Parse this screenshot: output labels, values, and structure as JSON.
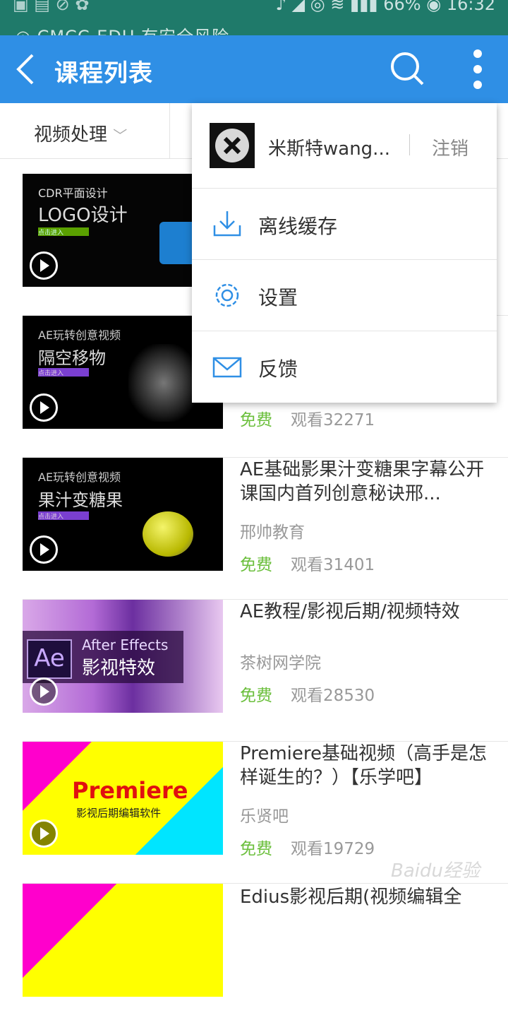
{
  "status_bar": {
    "battery": "66%",
    "time": "16:32"
  },
  "notification": "CMCC-EDU 有安全风险",
  "app_bar": {
    "title": "课程列表"
  },
  "filter": {
    "category": "视频处理"
  },
  "menu": {
    "user_name": "米斯特wang...",
    "logout_label": "注销",
    "items": [
      {
        "label": "离线缓存",
        "icon": "download-icon"
      },
      {
        "label": "设置",
        "icon": "gear-icon"
      },
      {
        "label": "反馈",
        "icon": "mail-icon"
      }
    ]
  },
  "courses": [
    {
      "thumb_lines": [
        "CDR平面设计",
        "LOGO设计",
        "点击进入"
      ],
      "title": "",
      "org": "",
      "price": "",
      "views": ""
    },
    {
      "thumb_lines": [
        "AE玩转创意视频",
        "隔空移物",
        "点击进入"
      ],
      "title": "",
      "org": "",
      "price": "免费",
      "views": "观看32271"
    },
    {
      "thumb_lines": [
        "AE玩转创意视频",
        "果汁变糖果",
        "点击进入"
      ],
      "title": "AE基础影果汁变糖果字幕公开课国内首列创意秘诀邢...",
      "org": "邢帅教育",
      "price": "免费",
      "views": "观看31401"
    },
    {
      "thumb_lines": [
        "After Effects",
        "影视特效",
        "Ae"
      ],
      "title": "AE教程/影视后期/视频特效",
      "org": "茶树网学院",
      "price": "免费",
      "views": "观看28530"
    },
    {
      "thumb_lines": [
        "Premiere",
        "影视后期编辑软件"
      ],
      "title": "Premiere基础视频（高手是怎样诞生的？）【乐学吧】",
      "org": "乐贤吧",
      "price": "免费",
      "views": "观看19729"
    },
    {
      "thumb_lines": [],
      "title": "Edius影视后期(视频编辑全",
      "org": "",
      "price": "",
      "views": ""
    }
  ],
  "watermark": "Baidu经验",
  "colors": {
    "appbar": "#2f8fe5",
    "statusbar": "#1f7a6a",
    "free": "#6bbf3c",
    "menu_icon": "#2f8fe5"
  }
}
